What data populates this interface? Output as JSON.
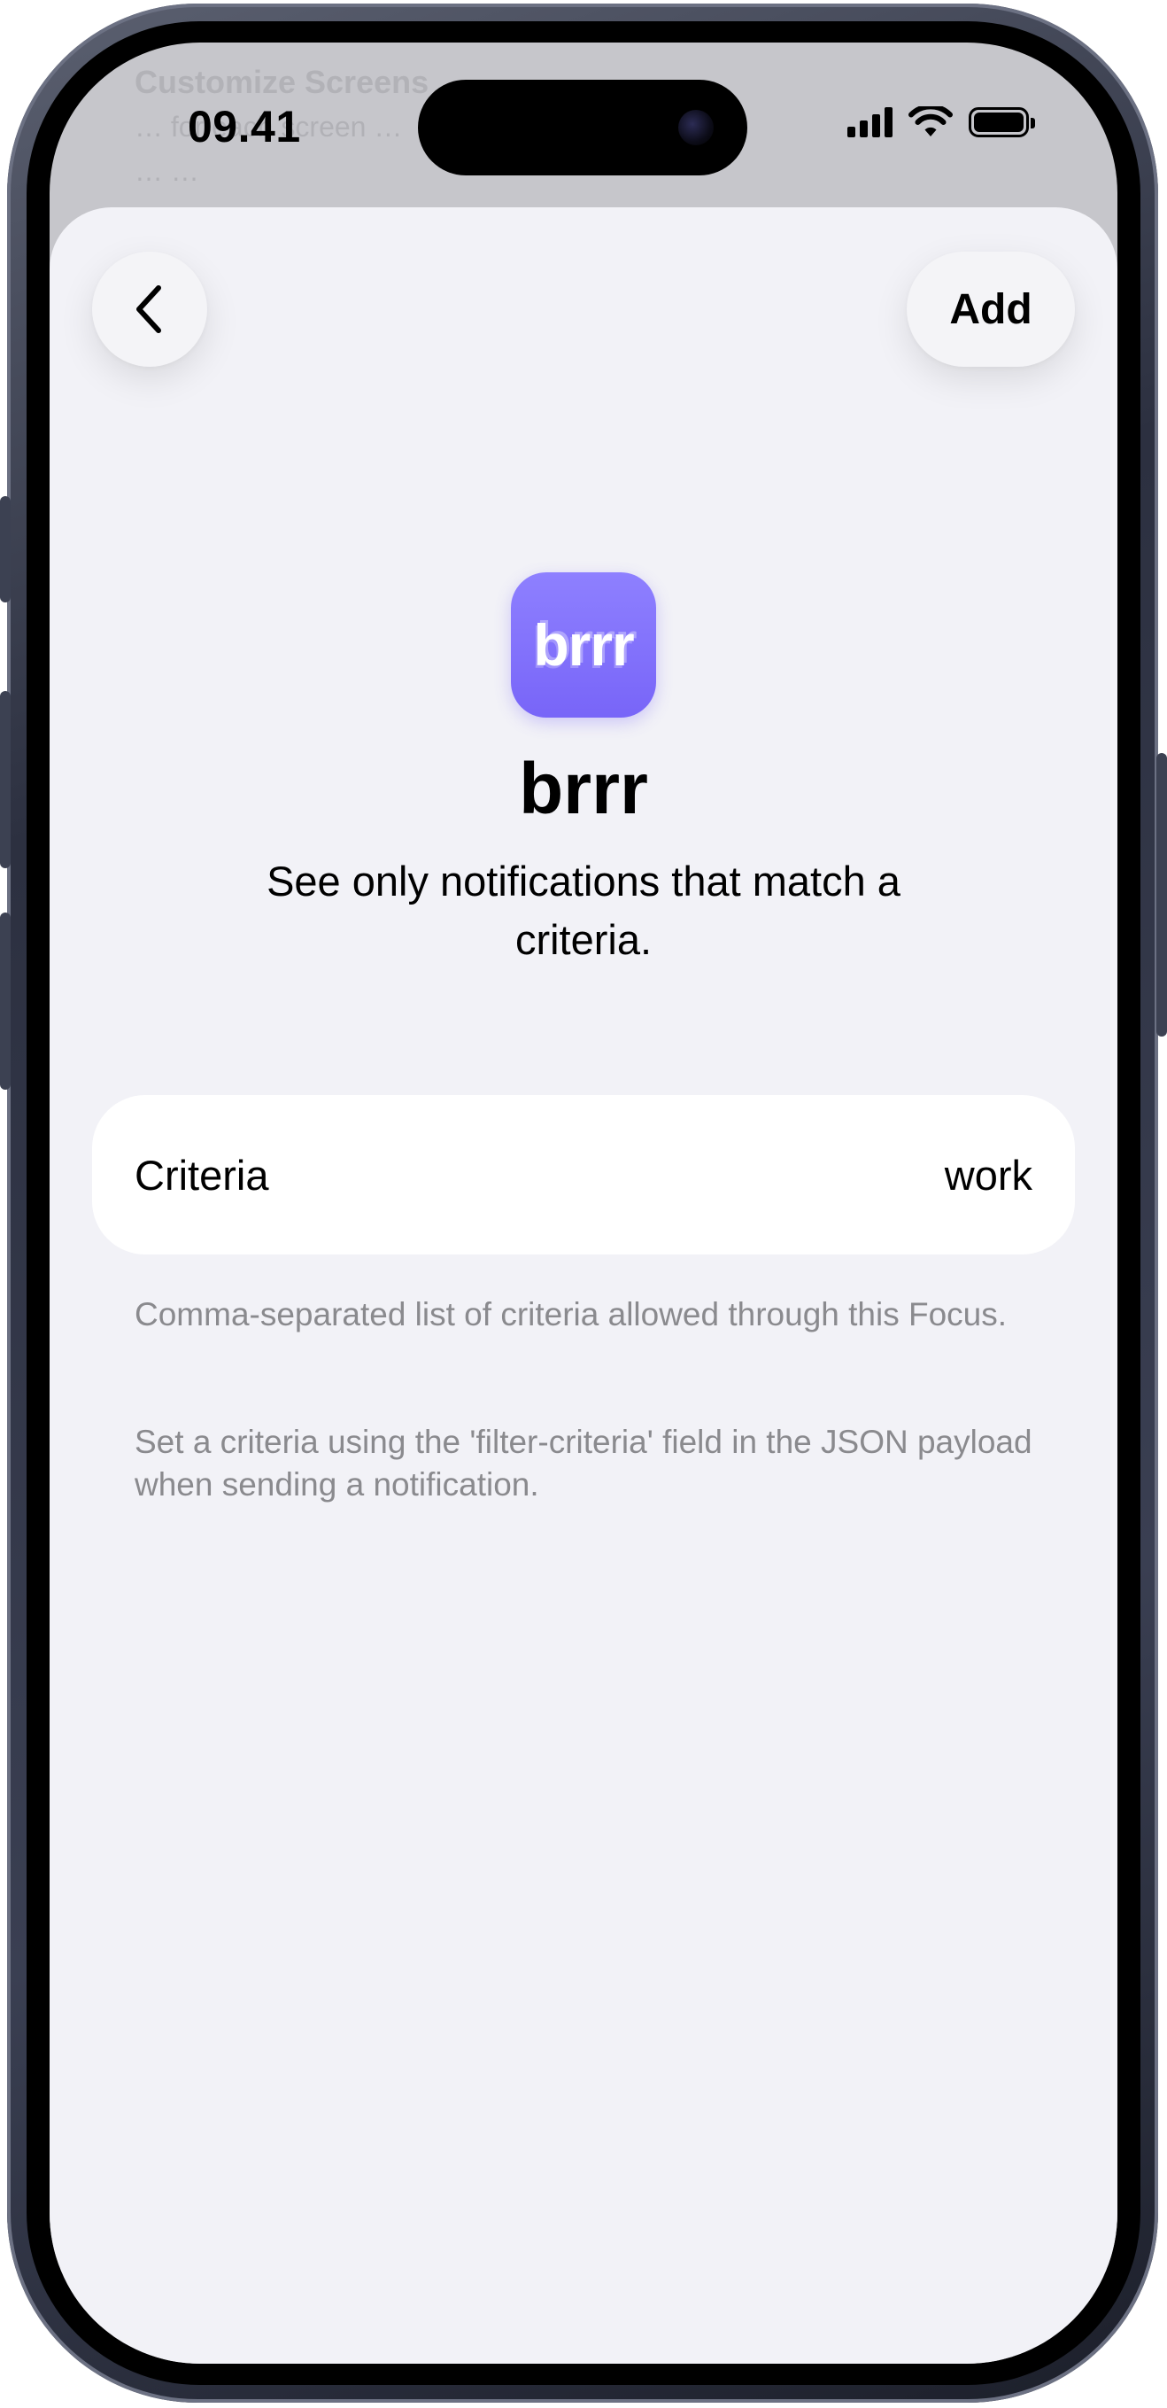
{
  "background_screen": {
    "title": "Customize Screens",
    "line1": "… for each screen …",
    "line2": "… …"
  },
  "status_bar": {
    "time": "09.41"
  },
  "nav": {
    "back_icon": "chevron-left-icon",
    "add_label": "Add"
  },
  "app": {
    "icon_text": "brrr",
    "icon_color": "#7b69f9",
    "name": "brrr",
    "description": "See only notifications that match a criteria."
  },
  "criteria_row": {
    "label": "Criteria",
    "value": "work"
  },
  "footnotes": {
    "first": "Comma-separated list of criteria allowed through this Focus.",
    "second": "Set a criteria using the 'filter-criteria' field in the JSON payload when sending a notification."
  }
}
